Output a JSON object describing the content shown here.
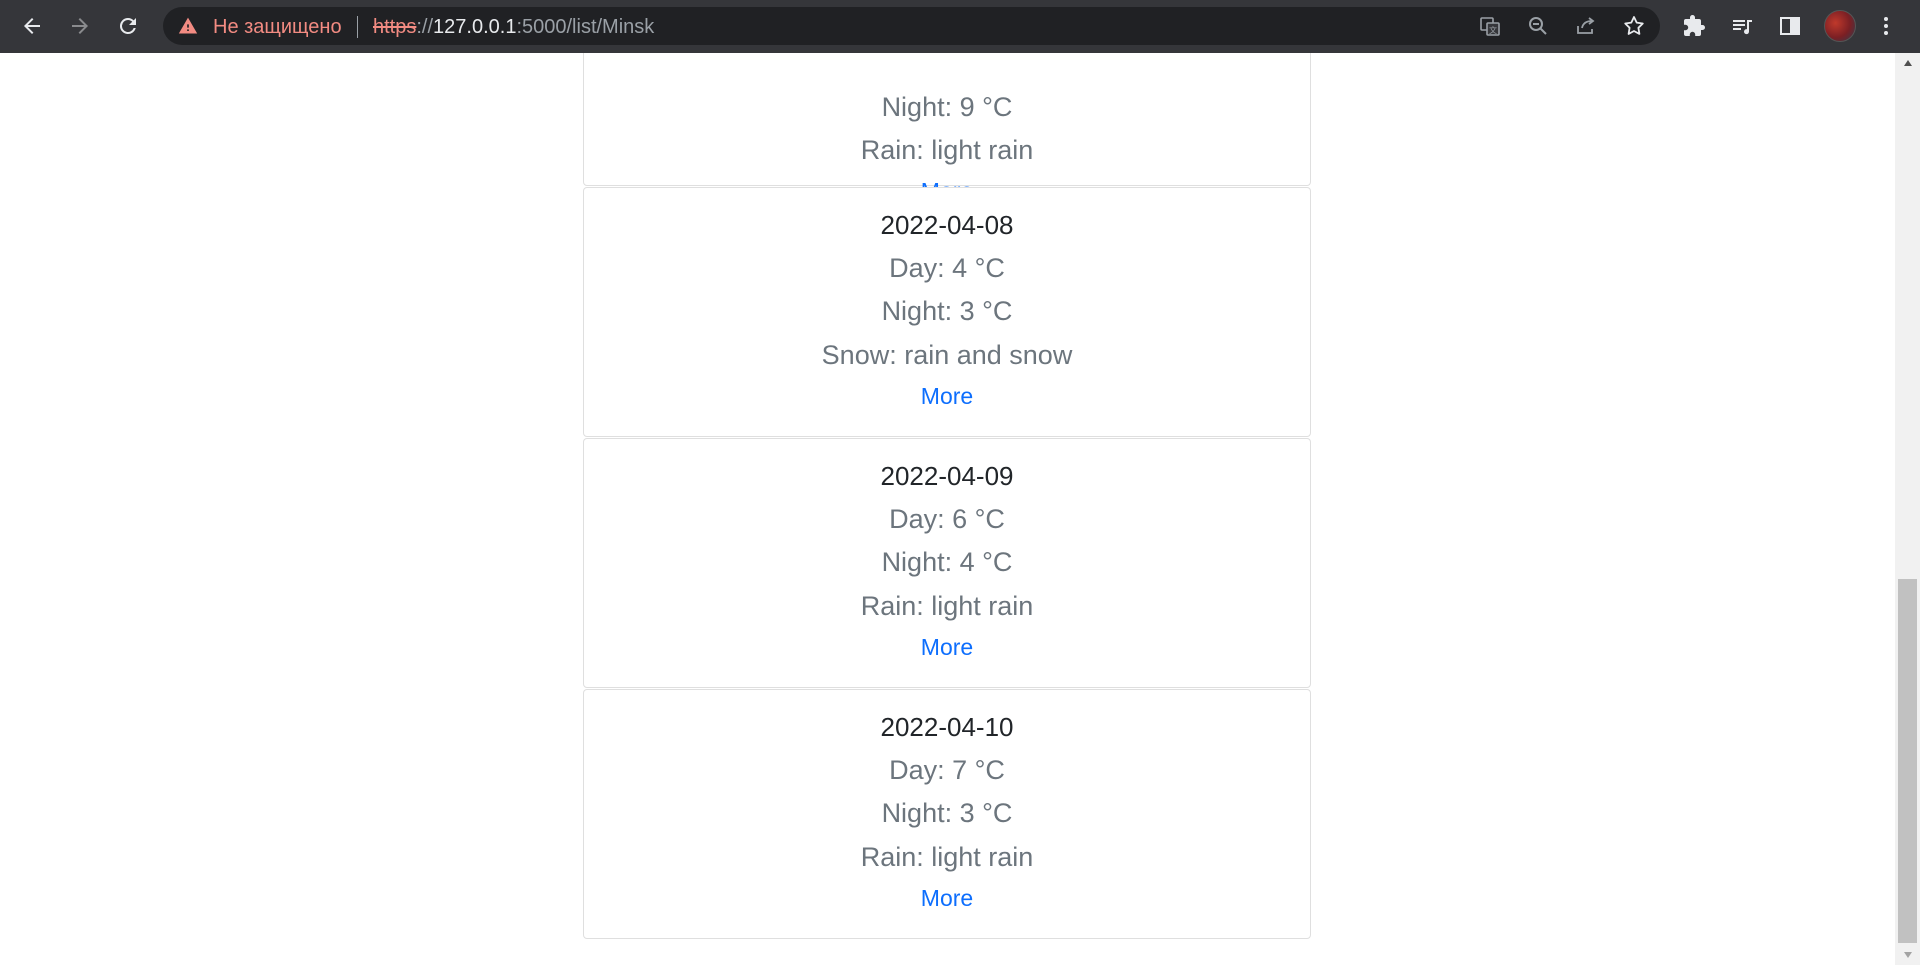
{
  "browser": {
    "security_label": "Не защищено",
    "url_scheme": "https",
    "url_sep": "://",
    "url_host": "127.0.0.1",
    "url_path": ":5000/list/Minsk"
  },
  "partial_card": {
    "night": "Night: 9 °C",
    "precip": "Rain: light rain",
    "more": "More"
  },
  "cards": [
    {
      "date": "2022-04-08",
      "day": "Day: 4 °C",
      "night": "Night: 3 °C",
      "precip": "Snow: rain and snow",
      "more": "More"
    },
    {
      "date": "2022-04-09",
      "day": "Day: 6 °C",
      "night": "Night: 4 °C",
      "precip": "Rain: light rain",
      "more": "More"
    },
    {
      "date": "2022-04-10",
      "day": "Day: 7 °C",
      "night": "Night: 3 °C",
      "precip": "Rain: light rain",
      "more": "More"
    }
  ]
}
